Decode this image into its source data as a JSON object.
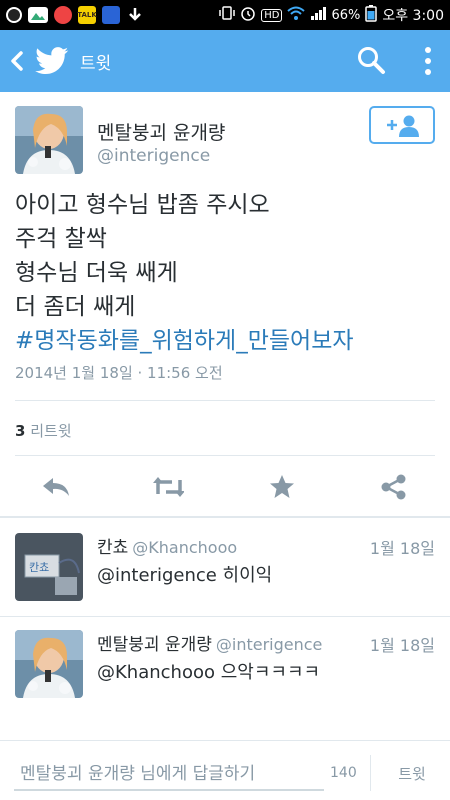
{
  "status_bar": {
    "notif_icons": [
      "notification-g-icon",
      "gallery-icon",
      "messenger-icon",
      "talk-icon",
      "game-icon",
      "download-icon"
    ],
    "talk_label": "TALK",
    "battery": "66%",
    "time": "오후 3:00",
    "hd_label": "HD"
  },
  "app_bar": {
    "title": "트윗",
    "color": "#55acee"
  },
  "author": {
    "name": "멘탈붕괴 윤개량",
    "handle": "@interigence"
  },
  "tweet": {
    "lines": [
      "아이고 형수님 밥좀 주시오",
      "주걱 찰싹",
      "형수님 더욱 쌔게",
      "더 좀더 쌔게"
    ],
    "hashtag": "#명작동화를_위험하게_만들어보자",
    "date": "2014년 1월 18일 · 11:56 오전"
  },
  "retweets": {
    "count": "3",
    "label": "리트윗"
  },
  "actions": [
    "reply-icon",
    "retweet-icon",
    "favorite-icon",
    "share-icon"
  ],
  "replies": [
    {
      "name": "칸쵸",
      "handle": "@Khanchooo",
      "date": "1월 18일",
      "text": "@interigence 히이익",
      "avatar_text": "칸쵸"
    },
    {
      "name": "멘탈붕괴 윤개량",
      "handle": "@interigence",
      "date": "1월 18일",
      "text": "@Khanchooo 으악ㅋㅋㅋㅋ"
    }
  ],
  "compose": {
    "placeholder": "멘탈붕괴 윤개량 님에게 답글하기",
    "count": "140",
    "button": "트윗"
  },
  "colors": {
    "accent": "#55acee",
    "link": "#2b7bb9",
    "muted": "#8899a6",
    "text": "#292f33"
  }
}
